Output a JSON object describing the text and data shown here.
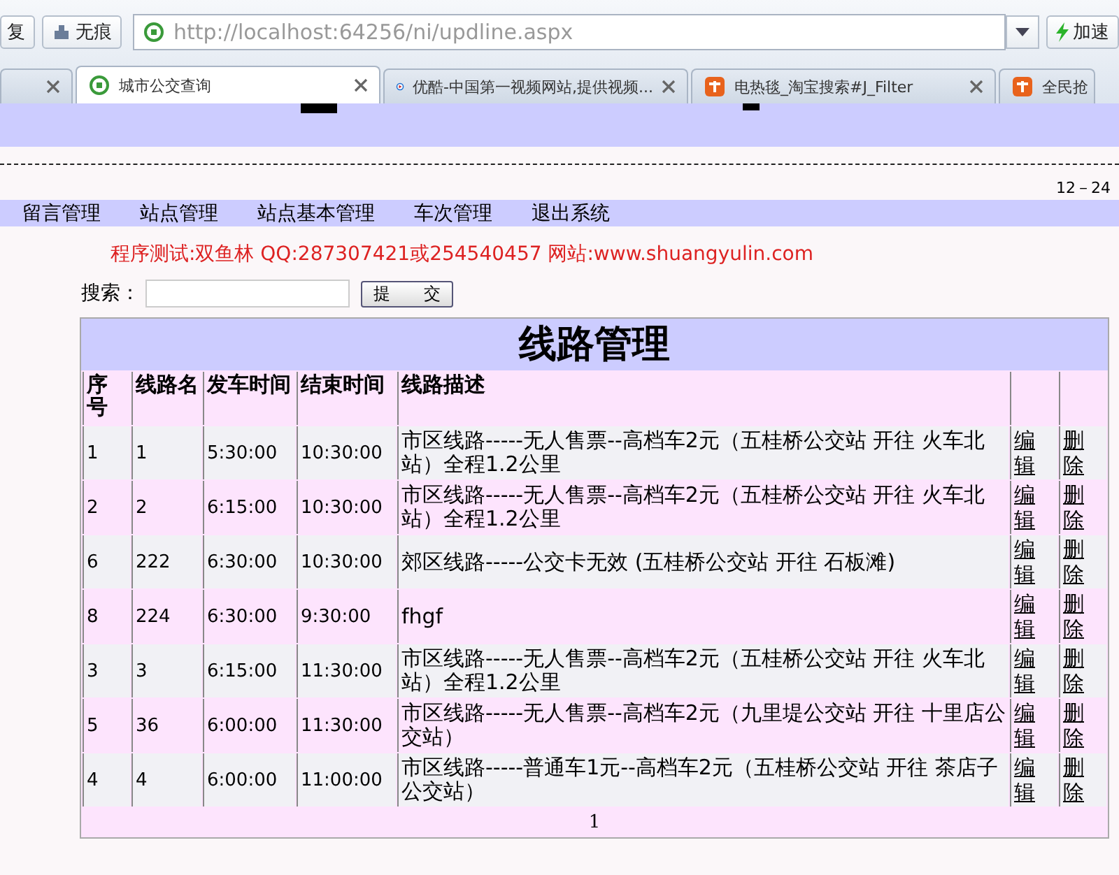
{
  "browser": {
    "restore_button": "复",
    "private_button": "无痕",
    "url": "http://localhost:64256/ni/updline.aspx",
    "speedup_button": "加速",
    "tabs": [
      {
        "selected": false
      },
      {
        "label": "城市公交查询",
        "selected": true
      },
      {
        "label": "优酷-中国第一视频网站,提供视频...",
        "selected": false
      },
      {
        "label": "电热毯_淘宝搜索#J_Filter",
        "selected": false
      },
      {
        "label": "全民抢",
        "selected": false
      }
    ]
  },
  "date": "12－24",
  "nav": [
    "留言管理",
    "站点管理",
    "站点基本管理",
    "车次管理",
    "退出系统"
  ],
  "notice": "程序测试:双鱼林 QQ:287307421或254540457 网站:www.shuangyulin.com",
  "search": {
    "label": "搜索：",
    "button": "提　　交"
  },
  "table": {
    "title": "线路管理",
    "columns": [
      "序号",
      "线路名",
      "发车时间",
      "结束时间",
      "线路描述"
    ],
    "rows": [
      {
        "cells": [
          "1",
          "1",
          "5:30:00",
          "10:30:00",
          "市区线路-----无人售票--高档车2元（五桂桥公交站 开往 火车北站）全程1.2公里"
        ],
        "edit": "编辑",
        "delete": "删除"
      },
      {
        "cells": [
          "2",
          "2",
          "6:15:00",
          "10:30:00",
          "市区线路-----无人售票--高档车2元（五桂桥公交站 开往 火车北站）全程1.2公里"
        ],
        "edit": "编辑",
        "delete": "删除"
      },
      {
        "cells": [
          "6",
          "222",
          "6:30:00",
          "10:30:00",
          "郊区线路-----公交卡无效  (五桂桥公交站 开往 石板滩)"
        ],
        "edit": "编辑",
        "delete": "删除"
      },
      {
        "cells": [
          "8",
          "224",
          "6:30:00",
          "9:30:00",
          "fhgf"
        ],
        "edit": "编辑",
        "delete": "删除"
      },
      {
        "cells": [
          "3",
          "3",
          "6:15:00",
          "11:30:00",
          "市区线路-----无人售票--高档车2元（五桂桥公交站 开往 火车北站）全程1.2公里"
        ],
        "edit": "编辑",
        "delete": "删除"
      },
      {
        "cells": [
          "5",
          "36",
          "6:00:00",
          "11:30:00",
          "市区线路-----无人售票--高档车2元（九里堤公交站 开往 十里店公交站）"
        ],
        "edit": "编辑",
        "delete": "删除"
      },
      {
        "cells": [
          "4",
          "4",
          "6:00:00",
          "11:00:00",
          "市区线路-----普通车1元--高档车2元（五桂桥公交站 开往 茶店子公交站）"
        ],
        "edit": "编辑",
        "delete": "删除"
      }
    ],
    "pager": "1"
  }
}
